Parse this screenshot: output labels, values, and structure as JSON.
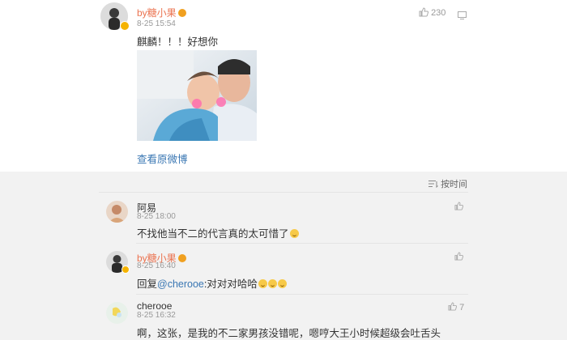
{
  "post": {
    "username": "by糖小果",
    "time": "8-25 15:54",
    "text": "麒麟！！！好想你",
    "like_count": "230",
    "link_label": "查看原微博"
  },
  "comments_panel": {
    "sort_label": "按时间"
  },
  "comments": [
    {
      "username": "阿易",
      "time": "8-25 18:00",
      "text": "不找他当不二的代言真的太可惜了",
      "like_count": ""
    },
    {
      "username": "by糖小果",
      "time": "8-25 16:40",
      "text_prefix": "回复",
      "mention": "@cherooe",
      "text": ":对对对哈哈",
      "like_count": ""
    },
    {
      "username": "cherooe",
      "time": "8-25 16:32",
      "text": "啊，这张，是我的不二家男孩没错呢，嗯哼大王小时候超级会吐舌头",
      "like_count": "7"
    }
  ],
  "colors": {
    "username": "#eb7350",
    "link": "#3a77b3",
    "muted": "#999999"
  },
  "icons": [
    "thumbs-up-icon",
    "menu-icon",
    "sort-icon",
    "verified-badge-icon",
    "medal-icon",
    "laugh-emoji-icon"
  ]
}
